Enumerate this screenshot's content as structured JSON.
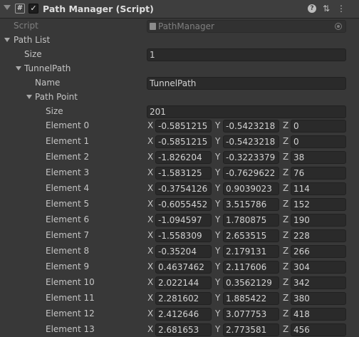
{
  "header": {
    "title": "Path Manager (Script)",
    "script_glyph": "#",
    "enabled_glyph": "✓",
    "help_glyph": "?",
    "settings_glyph": "⇅",
    "menu_glyph": "⋮"
  },
  "script_field": {
    "label": "Script",
    "value": "PathManager"
  },
  "path_list": {
    "label": "Path List",
    "size_label": "Size",
    "size": "1",
    "element": {
      "label": "TunnelPath",
      "name_label": "Name",
      "name": "TunnelPath",
      "points": {
        "label": "Path Point",
        "size_label": "Size",
        "size": "201",
        "axis": {
          "x": "X",
          "y": "Y",
          "z": "Z"
        },
        "items": [
          {
            "label": "Element 0",
            "x": "-0.5851215",
            "y": "-0.5423218",
            "z": "0"
          },
          {
            "label": "Element 1",
            "x": "-0.5851215",
            "y": "-0.5423218",
            "z": "0"
          },
          {
            "label": "Element 2",
            "x": "-1.826204",
            "y": "-0.3223379",
            "z": "38"
          },
          {
            "label": "Element 3",
            "x": "-1.583125",
            "y": "-0.7629622",
            "z": "76"
          },
          {
            "label": "Element 4",
            "x": "-0.3754126",
            "y": "0.9039023",
            "z": "114"
          },
          {
            "label": "Element 5",
            "x": "-0.6055452",
            "y": "3.515786",
            "z": "152"
          },
          {
            "label": "Element 6",
            "x": "-1.094597",
            "y": "1.780875",
            "z": "190"
          },
          {
            "label": "Element 7",
            "x": "-1.558309",
            "y": "2.653515",
            "z": "228"
          },
          {
            "label": "Element 8",
            "x": "-0.35204",
            "y": "2.179131",
            "z": "266"
          },
          {
            "label": "Element 9",
            "x": "0.4637462",
            "y": "2.117606",
            "z": "304"
          },
          {
            "label": "Element 10",
            "x": "2.022144",
            "y": "0.3562129",
            "z": "342"
          },
          {
            "label": "Element 11",
            "x": "2.281602",
            "y": "1.885422",
            "z": "380"
          },
          {
            "label": "Element 12",
            "x": "2.412646",
            "y": "3.077753",
            "z": "418"
          },
          {
            "label": "Element 13",
            "x": "2.681653",
            "y": "2.773581",
            "z": "456"
          }
        ]
      }
    }
  }
}
